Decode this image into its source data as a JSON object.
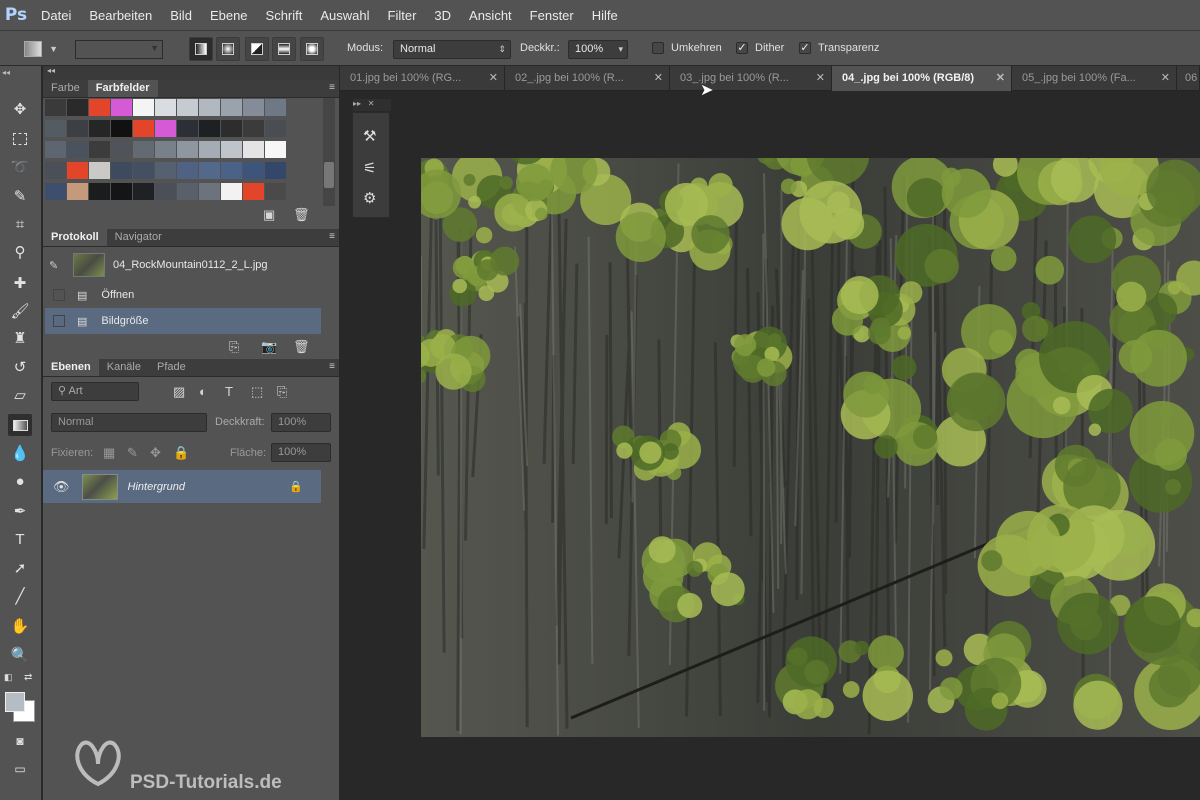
{
  "app": {
    "logo": "Ps"
  },
  "menu": [
    "Datei",
    "Bearbeiten",
    "Bild",
    "Ebene",
    "Schrift",
    "Auswahl",
    "Filter",
    "3D",
    "Ansicht",
    "Fenster",
    "Hilfe"
  ],
  "options": {
    "modus_label": "Modus:",
    "modus_value": "Normal",
    "deckkr_label": "Deckkr.:",
    "deckkr_value": "100%",
    "umkehren": "Umkehren",
    "dither": "Dither",
    "transparenz": "Transparenz"
  },
  "tabs": [
    {
      "label": "01.jpg bei 100% (RG...",
      "active": false
    },
    {
      "label": "02_.jpg bei 100% (R...",
      "active": false
    },
    {
      "label": "03_.jpg bei 100% (R...",
      "active": false
    },
    {
      "label": "04_.jpg bei 100% (RGB/8)",
      "active": true
    },
    {
      "label": "05_.jpg bei 100% (Fa...",
      "active": false
    },
    {
      "label": "06",
      "active": false
    }
  ],
  "swatches_panel": {
    "tabs": [
      "Farbe",
      "Farbfelder"
    ],
    "active": "Farbfelder",
    "colors": [
      [
        "#3a3a3a",
        "#2a2a2a",
        "#e2452a",
        "#d65ad6",
        "#f4f4f4",
        "#d9dce0",
        "#c6cbd1",
        "#b2b8c0",
        "#9aa2ac",
        "#838c98",
        "#6e7886"
      ],
      [
        "#545c63",
        "#3c4045",
        "#262626",
        "#111111",
        "#e2452a",
        "#d65ad6",
        "#2c3036",
        "#1e2124",
        "#2d2d2d",
        "#3b3b3b",
        "#4a4d52"
      ],
      [
        "#5d6670",
        "#4a535d",
        "#3c3c3c",
        "#50545a",
        "#646a72",
        "#78808a",
        "#8e96a0",
        "#a6acb4",
        "#bfc4ca",
        "#e4e4e4",
        "#f7f7f7"
      ],
      [
        "#4b5058",
        "#e2452a",
        "#cbc9c6",
        "#3e4a5e",
        "#445061",
        "#556171",
        "#506283",
        "#53698c",
        "#4b6288",
        "#3e557b",
        "#32476a"
      ],
      [
        "#3e4f6d",
        "#c49a7a",
        "#1b1c1e",
        "#141517",
        "#202125",
        "#4a4f58",
        "#5a6069",
        "#6d737c",
        "#f2f2f2",
        "#e2452a",
        "#4a4a4a"
      ]
    ]
  },
  "history_panel": {
    "tabs": [
      "Protokoll",
      "Navigator"
    ],
    "active": "Protokoll",
    "snapshot": "04_RockMountain0112_2_L.jpg",
    "items": [
      "Öffnen",
      "Bildgröße"
    ]
  },
  "layers_panel": {
    "tabs": [
      "Ebenen",
      "Kanäle",
      "Pfade"
    ],
    "active": "Ebenen",
    "filter": "Art",
    "blend": "Normal",
    "opacity_label": "Deckkraft:",
    "opacity_value": "100%",
    "lock_label": "Fixieren:",
    "fill_label": "Fläche:",
    "fill_value": "100%",
    "layer_name": "Hintergrund"
  },
  "watermark": "PSD-Tutorials.de",
  "colors": {
    "panel": "#535353",
    "dark": "#282828",
    "selection": "#5a6a80",
    "accent_tab": "#b2d3ff"
  }
}
